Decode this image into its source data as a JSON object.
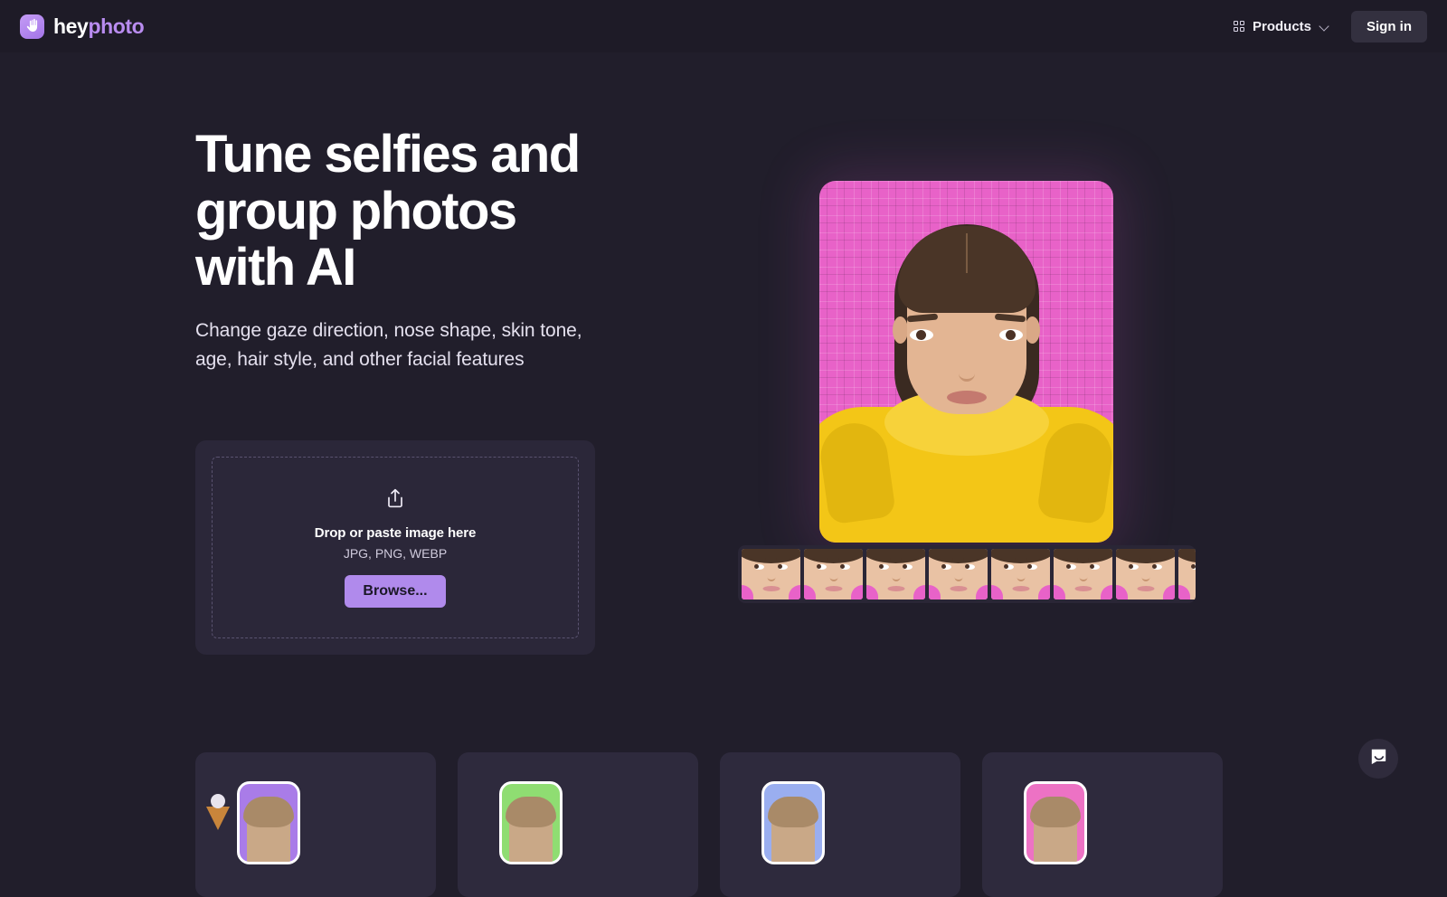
{
  "header": {
    "brand": {
      "hey": "hey",
      "photo": "photo",
      "logo_icon": "waving-hand-icon"
    },
    "products_label": "Products",
    "products_icon": "grid-icon",
    "chevron_icon": "chevron-down-icon",
    "signin_label": "Sign in",
    "background": "#1E1B27"
  },
  "hero": {
    "title": "Tune selfies and group photos with AI",
    "subtitle": "Change gaze direction, nose shape, skin tone, age, hair style, and other facial features"
  },
  "upload": {
    "icon": "upload-share-icon",
    "title": "Drop or paste image here",
    "formats": "JPG, PNG, WEBP",
    "browse_label": "Browse...",
    "browse_color": "#B08AEC",
    "card_background": "#2B2739"
  },
  "hero_image": {
    "alt": "portrait-of-woman-in-yellow-raycoat-on-pink-grid-background",
    "backdrop_color": "#E862C8",
    "jacket_color": "#F3C617"
  },
  "filmstrip": {
    "alt": "face-variation-thumbnails",
    "thumbnails": [
      {
        "name": "gaze-variation-1"
      },
      {
        "name": "gaze-variation-2"
      },
      {
        "name": "gaze-variation-3"
      },
      {
        "name": "gaze-variation-4"
      },
      {
        "name": "gaze-variation-5"
      },
      {
        "name": "gaze-variation-6"
      },
      {
        "name": "gaze-variation-7"
      },
      {
        "name": "gaze-variation-8"
      }
    ]
  },
  "feature_cards": [
    {
      "name": "feature-card-1",
      "thumb_color": "#A97CE8",
      "has_deco": true
    },
    {
      "name": "feature-card-2",
      "thumb_color": "#8FDD72",
      "has_deco": false
    },
    {
      "name": "feature-card-3",
      "thumb_color": "#9AAEF0",
      "has_deco": false
    },
    {
      "name": "feature-card-4",
      "thumb_color": "#ED72C4",
      "has_deco": false
    }
  ],
  "chat": {
    "icon": "chat-bubble-icon",
    "background": "#2F2B3C"
  },
  "page": {
    "background": "#211E2B"
  }
}
